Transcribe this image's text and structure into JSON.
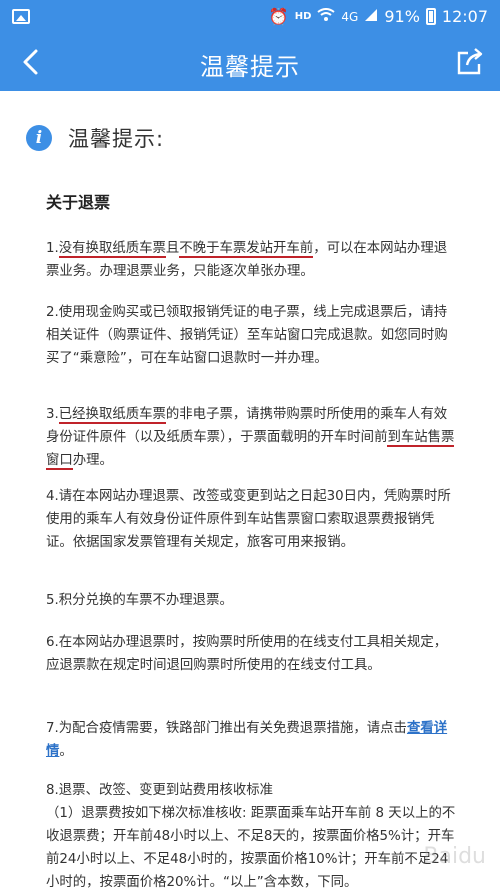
{
  "status_bar": {
    "hd": "HD",
    "signal": "4G",
    "battery": "91%",
    "time": "12:07"
  },
  "nav": {
    "title": "温馨提示"
  },
  "heading": {
    "title": "温馨提示:"
  },
  "section_title": "关于退票",
  "p1": {
    "num": "1.",
    "u1": "没有换取纸质车票",
    "mid": "且",
    "u2": "不晚于车票发站开车前",
    "rest": "，可以在本网站办理退票业务。办理退票业务，只能逐次单张办理。"
  },
  "p2": "2.使用现金购买或已领取报销凭证的电子票，线上完成退票后，请持相关证件（购票证件、报销凭证）至车站窗口完成退款。如您同时购买了“乘意险”，可在车站窗口退款时一并办理。",
  "p3": {
    "num": "3.",
    "u1": "已经换取纸质车票",
    "mid": "的非电子票，请携带购票时所使用的乘车人有效身份证件原件（以及纸质车票），于票面载明的开车时间前",
    "u2": "到车站售票窗口",
    "rest": "办理。"
  },
  "p4": "4.请在本网站办理退票、改签或变更到站之日起30日内，凭购票时所使用的乘车人有效身份证件原件到车站售票窗口索取退票费报销凭证。依据国家发票管理有关规定，旅客可用来报销。",
  "p5": "5.积分兑换的车票不办理退票。",
  "p6": "6.在本网站办理退票时，按购票时所使用的在线支付工具相关规定，应退票款在规定时间退回购票时所使用的在线支付工具。",
  "p7": {
    "text": "7.为配合疫情需要，铁路部门推出有关免费退票措施，请点击",
    "link": "查看详情",
    "end": "。"
  },
  "p8": {
    "title": "8.退票、改签、变更到站费用核收标准",
    "body": "（1）退票费按如下梯次标准核收: 距票面乘车站开车前 8 天以上的不收退票费；开车前48小时以上、不足8天的，按票面价格5%计；开车前24小时以上、不足48小时的，按票面价格10%计；开车前不足24小时的，按票面价格20%计。“以上”含本数，下同。"
  },
  "watermark": "Baidu",
  "colors": {
    "primary": "#3d8fe5",
    "underline": "#c0232a",
    "link": "#2d72c8"
  },
  "icons": [
    "image-icon",
    "alarm-icon",
    "wifi-icon",
    "signal-icon",
    "battery-icon",
    "back-arrow-icon",
    "share-icon",
    "info-icon"
  ]
}
